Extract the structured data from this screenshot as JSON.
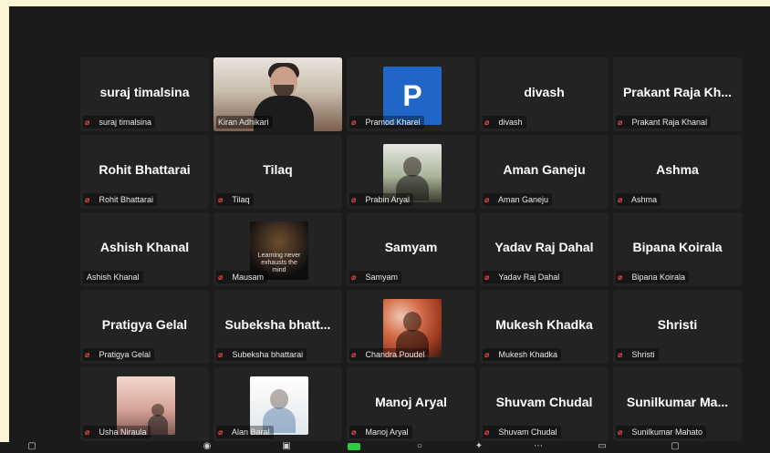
{
  "participants": [
    {
      "display": "suraj timalsina",
      "label": "suraj timalsina",
      "muted": true
    },
    {
      "display": "",
      "label": "Kiran Adhikari",
      "muted": false,
      "video": true,
      "active": true
    },
    {
      "display": "",
      "label": "Pramod Kharel",
      "muted": true,
      "avatar": "P"
    },
    {
      "display": "divash",
      "label": "divash",
      "muted": true
    },
    {
      "display": "Prakant Raja Kh...",
      "label": "Prakant Raja Khanal",
      "muted": true
    },
    {
      "display": "Rohit Bhattarai",
      "label": "Rohit Bhattarai",
      "muted": true
    },
    {
      "display": "Tilaq",
      "label": "Tilaq",
      "muted": true
    },
    {
      "display": "",
      "label": "Prabin Aryal",
      "muted": true,
      "photo": "photo-1"
    },
    {
      "display": "Aman Ganeju",
      "label": "Aman Ganeju",
      "muted": true
    },
    {
      "display": "Ashma",
      "label": "Ashma",
      "muted": true
    },
    {
      "display": "Ashish Khanal",
      "label": "Ashish Khanal",
      "muted": false
    },
    {
      "display": "",
      "label": "Mausam",
      "muted": true,
      "photo": "photo-2",
      "caption": "Learning never exhausts the mind"
    },
    {
      "display": "Samyam",
      "label": "Samyam",
      "muted": true
    },
    {
      "display": "Yadav Raj Dahal",
      "label": "Yadav Raj Dahal",
      "muted": true
    },
    {
      "display": "Bipana Koirala",
      "label": "Bipana Koirala",
      "muted": true
    },
    {
      "display": "Pratigya Gelal",
      "label": "Pratigya Gelal",
      "muted": true
    },
    {
      "display": "Subeksha bhatt...",
      "label": "Subeksha bhattarai",
      "muted": true
    },
    {
      "display": "",
      "label": "Chandra Poudel",
      "muted": true,
      "photo": "photo-3"
    },
    {
      "display": "Mukesh Khadka",
      "label": "Mukesh Khadka",
      "muted": true
    },
    {
      "display": "Shristi",
      "label": "Shristi",
      "muted": true
    },
    {
      "display": "",
      "label": "Usha Niraula",
      "muted": true,
      "photo": "photo-4"
    },
    {
      "display": "",
      "label": "Alan Baral",
      "muted": true,
      "photo": "photo-5"
    },
    {
      "display": "Manoj Aryal",
      "label": "Manoj Aryal",
      "muted": true
    },
    {
      "display": "Shuvam Chudal",
      "label": "Shuvam Chudal",
      "muted": true
    },
    {
      "display": "Sunilkumar Ma...",
      "label": "Sunilkumar Mahato",
      "muted": true
    }
  ],
  "icons": {
    "mic_muted": "mic-muted-icon"
  },
  "colors": {
    "active_border": "#b6e04a",
    "muted_mic": "#ff4b4b",
    "tile_bg": "#232323",
    "frame_bg": "#1b1b1b"
  }
}
